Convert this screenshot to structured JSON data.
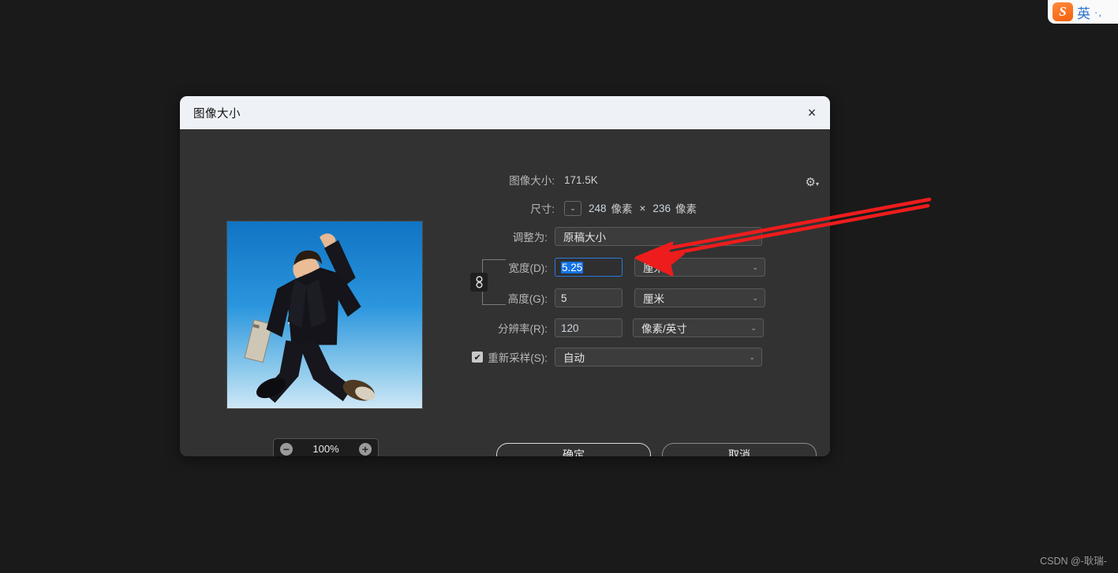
{
  "ime": {
    "logo_letter": "S",
    "language": "英",
    "dots": "·,"
  },
  "dialog": {
    "title": "图像大小",
    "close_icon": "×",
    "image_size": {
      "label": "图像大小:",
      "value": "171.5K"
    },
    "gear_icon": "⚙",
    "dimensions": {
      "label": "尺寸:",
      "toggle_icon": "⌄",
      "width_value": "248",
      "width_unit": "像素",
      "separator": "×",
      "height_value": "236",
      "height_unit": "像素"
    },
    "fit_to": {
      "label": "调整为:",
      "value": "原稿大小"
    },
    "width": {
      "label": "宽度(D):",
      "value": "5.25",
      "unit": "厘米"
    },
    "height": {
      "label": "高度(G):",
      "value": "5",
      "unit": "厘米"
    },
    "resolution": {
      "label": "分辨率(R):",
      "value": "120",
      "unit": "像素/英寸"
    },
    "resample": {
      "label": "重新采样(S):",
      "checked_mark": "✔",
      "value": "自动"
    },
    "chain_icon": "⛓",
    "zoom": {
      "minus": "−",
      "percent": "100%",
      "plus": "+"
    },
    "buttons": {
      "ok": "确定",
      "cancel": "取消"
    }
  },
  "annotation": {
    "color": "#ee1c1c"
  },
  "watermark": "CSDN @-耿瑞-"
}
